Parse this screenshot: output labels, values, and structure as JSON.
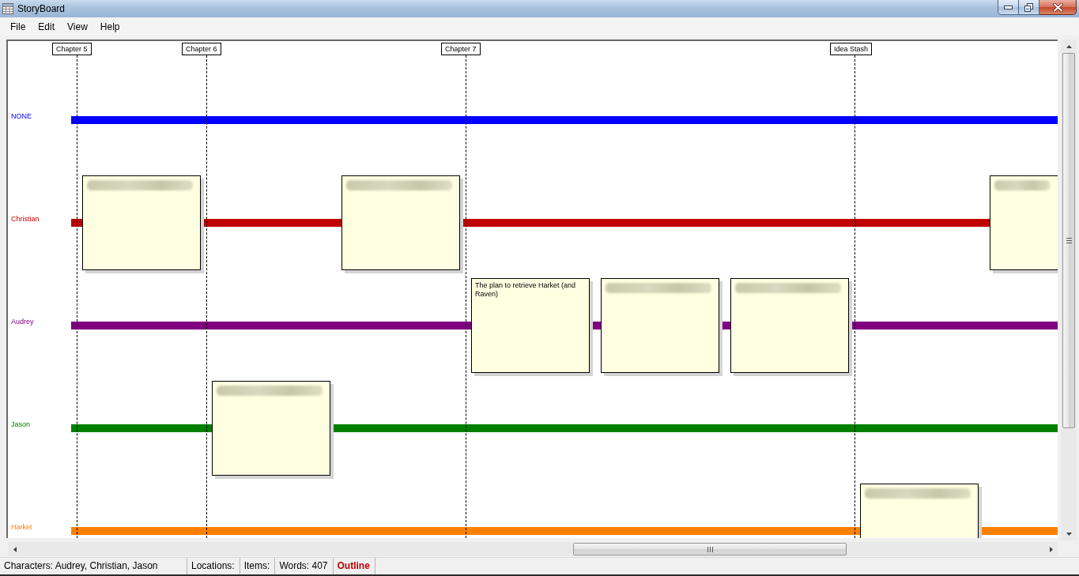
{
  "window": {
    "title": "StoryBoard"
  },
  "menu": [
    "File",
    "Edit",
    "View",
    "Help"
  ],
  "timeline": {
    "columns": [
      {
        "kind": "chapter",
        "label": "Chapter 5"
      },
      {
        "kind": "chapter",
        "label": "Chapter 6"
      },
      {
        "kind": "plain"
      },
      {
        "kind": "chapter",
        "label": "Chapter 7"
      },
      {
        "kind": "plain"
      },
      {
        "kind": "plain"
      },
      {
        "kind": "chapter",
        "label": "Idea Stash"
      },
      {
        "kind": "plain"
      }
    ],
    "lanes": [
      {
        "name": "NONE",
        "color": "#0000ff"
      },
      {
        "name": "Christian",
        "color": "#c00000",
        "slots": [
          {
            "kind": "blurred"
          },
          {
            "kind": "empty"
          },
          {
            "kind": "blurred"
          },
          {
            "kind": "empty"
          },
          {
            "kind": "empty"
          },
          {
            "kind": "empty"
          },
          {
            "kind": "empty"
          },
          {
            "kind": "blurred"
          }
        ]
      },
      {
        "name": "Audrey",
        "color": "#800080",
        "slots": [
          {
            "kind": "empty"
          },
          {
            "kind": "empty"
          },
          {
            "kind": "empty"
          },
          {
            "kind": "note",
            "text": "The plan to retrieve Harket (and Raven)"
          },
          {
            "kind": "blurred"
          },
          {
            "kind": "blurred"
          }
        ]
      },
      {
        "name": "Jason",
        "color": "#008000",
        "slots": [
          {
            "kind": "empty"
          },
          {
            "kind": "blurred"
          }
        ]
      },
      {
        "name": "Harket",
        "color": "#ff8000",
        "slots": [
          {
            "kind": "empty"
          },
          {
            "kind": "empty"
          },
          {
            "kind": "empty"
          },
          {
            "kind": "empty"
          },
          {
            "kind": "empty"
          },
          {
            "kind": "empty"
          },
          {
            "kind": "blurred"
          }
        ]
      }
    ]
  },
  "status_bar": [
    {
      "kind": "field",
      "text": "Characters: Audrey, Christian, Jason"
    },
    {
      "kind": "field",
      "text": "Locations:"
    },
    {
      "kind": "field",
      "text": "Items:"
    },
    {
      "kind": "field",
      "text": "Words: 407"
    },
    {
      "kind": "mode",
      "text": "Outline"
    }
  ]
}
